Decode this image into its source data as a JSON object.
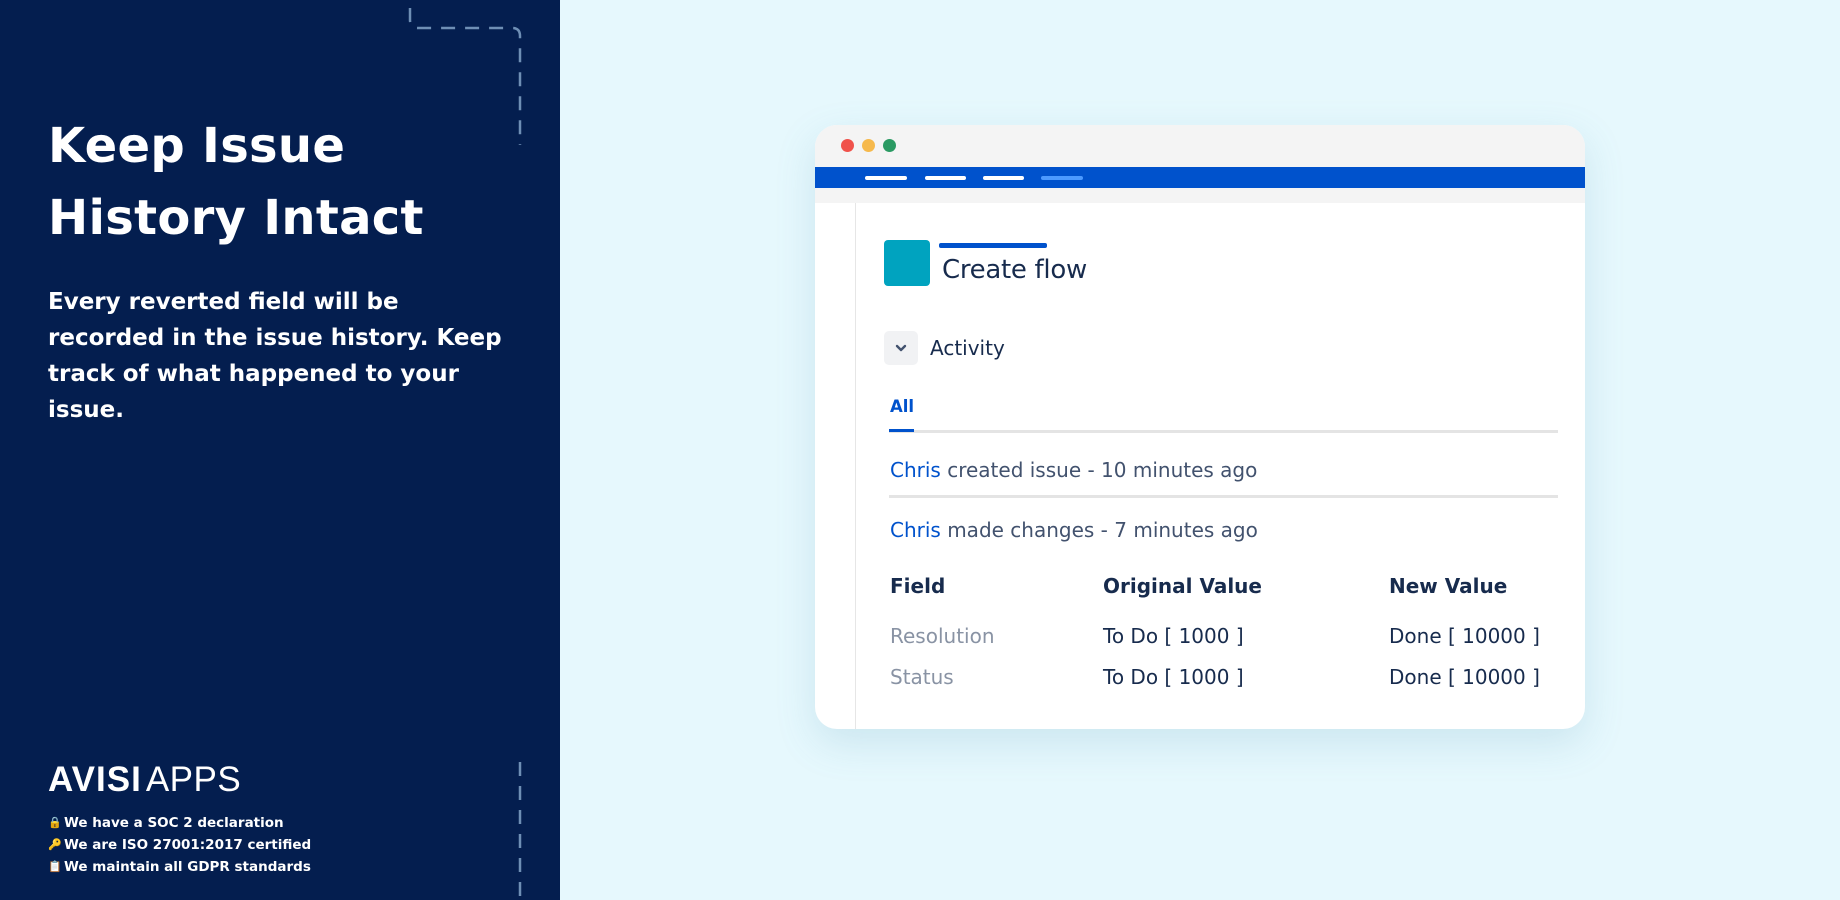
{
  "left": {
    "headline": "Keep Issue History Intact",
    "subline": "Every reverted field will be recorded in the issue history. Keep track of what happened to your issue.",
    "brand": {
      "strong": "AVISI",
      "light": "APPS"
    },
    "certs": [
      {
        "icon": "🔒",
        "text": "We have a SOC 2 declaration"
      },
      {
        "icon": "🔑",
        "text": "We are ISO 27001:2017 certified"
      },
      {
        "icon": "📋",
        "text": "We maintain all GDPR standards"
      }
    ]
  },
  "window": {
    "issue_title": "Create flow",
    "activity_label": "Activity",
    "tab_all": "All",
    "entries": [
      {
        "user": "Chris",
        "text": " created issue - 10 minutes ago"
      },
      {
        "user": "Chris",
        "text": " made changes - 7 minutes ago"
      }
    ],
    "table": {
      "headers": [
        "Field",
        "Original Value",
        "New Value"
      ],
      "rows": [
        [
          "Resolution",
          "To Do [ 1000 ]",
          "Done [ 10000 ]"
        ],
        [
          "Status",
          "To Do [ 1000 ]",
          "Done [ 10000 ]"
        ]
      ]
    }
  },
  "colors": {
    "panel_bg": "#041e4f",
    "page_bg": "#e6f8fd",
    "jira_blue": "#0052cc",
    "issue_icon": "#00a3bf"
  }
}
